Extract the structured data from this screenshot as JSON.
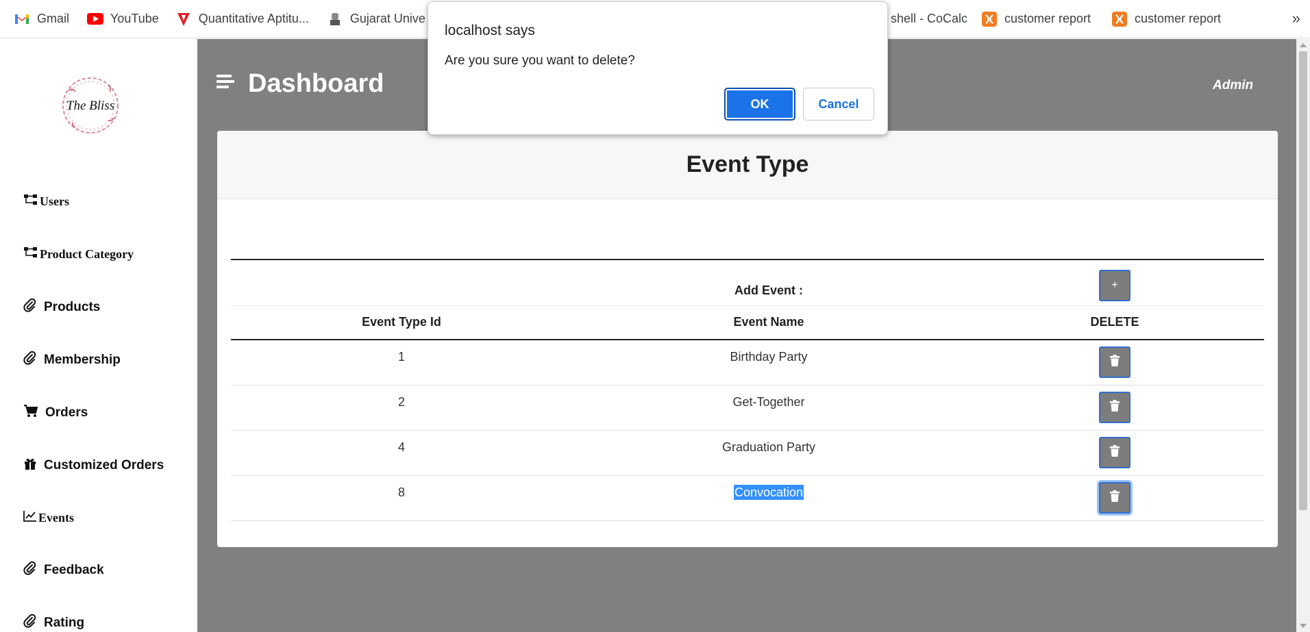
{
  "bookmarks": [
    {
      "label": "Gmail",
      "icon": "gmail-icon"
    },
    {
      "label": "YouTube",
      "icon": "youtube-icon"
    },
    {
      "label": "Quantitative Aptitu...",
      "icon": "quantitative-icon"
    },
    {
      "label": "Gujarat Unive",
      "icon": "university-icon"
    },
    {
      "label": "shell - CoCalc",
      "icon": ""
    },
    {
      "label": "customer report",
      "icon": "xampp-icon"
    },
    {
      "label": "customer report",
      "icon": "xampp-icon"
    }
  ],
  "bookmarks_more": "»",
  "sidebar": {
    "logo_text": "The Bliss",
    "items": [
      {
        "label": "Users",
        "icon": "sitemap-icon"
      },
      {
        "label": "Product Category",
        "icon": "sitemap-icon"
      },
      {
        "label": "Products",
        "icon": "paperclip-icon"
      },
      {
        "label": "Membership",
        "icon": "paperclip-icon"
      },
      {
        "label": "Orders",
        "icon": "cart-icon"
      },
      {
        "label": "Customized Orders",
        "icon": "gift-icon"
      },
      {
        "label": "Events",
        "icon": "chart-line-icon"
      },
      {
        "label": "Feedback",
        "icon": "paperclip-icon"
      },
      {
        "label": "Rating",
        "icon": "paperclip-icon"
      }
    ]
  },
  "header": {
    "title": "Dashboard",
    "user": "Admin"
  },
  "card": {
    "title": "Event Type",
    "add_label": "Add Event :",
    "add_button": "+",
    "columns": [
      "Event Type Id",
      "Event Name",
      "DELETE"
    ],
    "rows": [
      {
        "id": "1",
        "name": "Birthday Party"
      },
      {
        "id": "2",
        "name": "Get-Together"
      },
      {
        "id": "4",
        "name": "Graduation Party"
      },
      {
        "id": "8",
        "name": "Convocation"
      }
    ]
  },
  "dialog": {
    "title": "localhost says",
    "message": "Are you sure you want to delete?",
    "ok": "OK",
    "cancel": "Cancel"
  },
  "colors": {
    "accent": "#1a73e8",
    "main_bg": "#808080",
    "selection": "#3390ff"
  }
}
